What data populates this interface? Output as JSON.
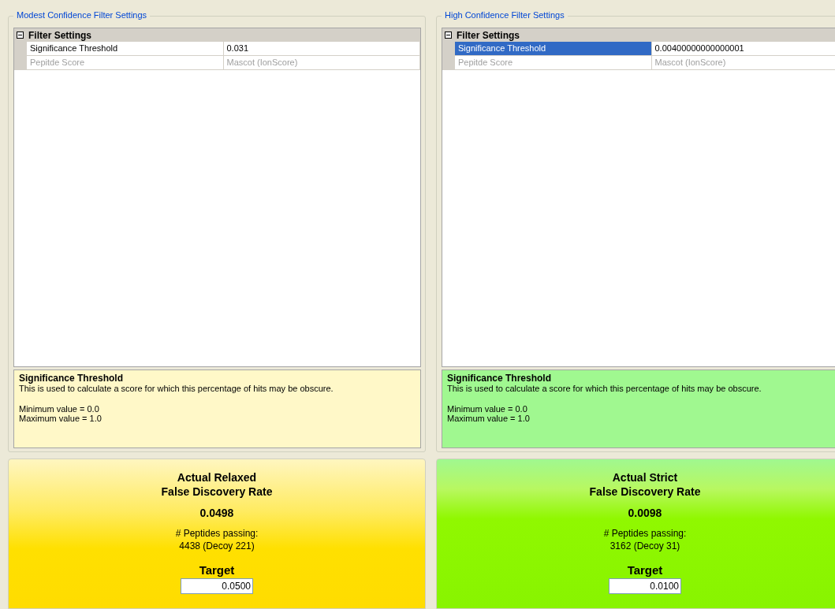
{
  "panels": [
    {
      "kind": "modest",
      "title": "Modest Confidence Filter Settings",
      "category": {
        "label": "Filter Settings",
        "expanded": true
      },
      "rows": [
        {
          "name": "Significance Threshold",
          "value": "0.031",
          "selected": false,
          "disabled": false
        },
        {
          "name": "Pepitde Score",
          "value": "Mascot (IonScore)",
          "selected": false,
          "disabled": true
        }
      ],
      "help": {
        "title": "Significance Threshold",
        "text": "This is used to calculate a score for which this percentage of hits may be obscure.",
        "lines": [
          "Minimum value = 0.0",
          "Maximum value = 1.0"
        ]
      },
      "result": {
        "heading": [
          "Actual Relaxed",
          "False Discovery Rate"
        ],
        "rate": "0.0498",
        "passing_label": "# Peptides passing:",
        "passing": "4438 (Decoy 221)",
        "target_label": "Target",
        "target": "0.0500"
      }
    },
    {
      "kind": "high",
      "title": "High Confidence Filter Settings",
      "category": {
        "label": "Filter Settings",
        "expanded": true
      },
      "rows": [
        {
          "name": "Significance Threshold",
          "value": "0.00400000000000001",
          "selected": true,
          "disabled": false
        },
        {
          "name": "Pepitde Score",
          "value": "Mascot (IonScore)",
          "selected": false,
          "disabled": true
        }
      ],
      "help": {
        "title": "Significance Threshold",
        "text": "This is used to calculate a score for which this percentage of hits may be obscure.",
        "lines": [
          "Minimum value = 0.0",
          "Maximum value = 1.0"
        ]
      },
      "result": {
        "heading": [
          "Actual Strict",
          "False Discovery Rate"
        ],
        "rate": "0.0098",
        "passing_label": "# Peptides passing:",
        "passing": "3162 (Decoy 31)",
        "target_label": "Target",
        "target": "0.0100"
      }
    }
  ]
}
